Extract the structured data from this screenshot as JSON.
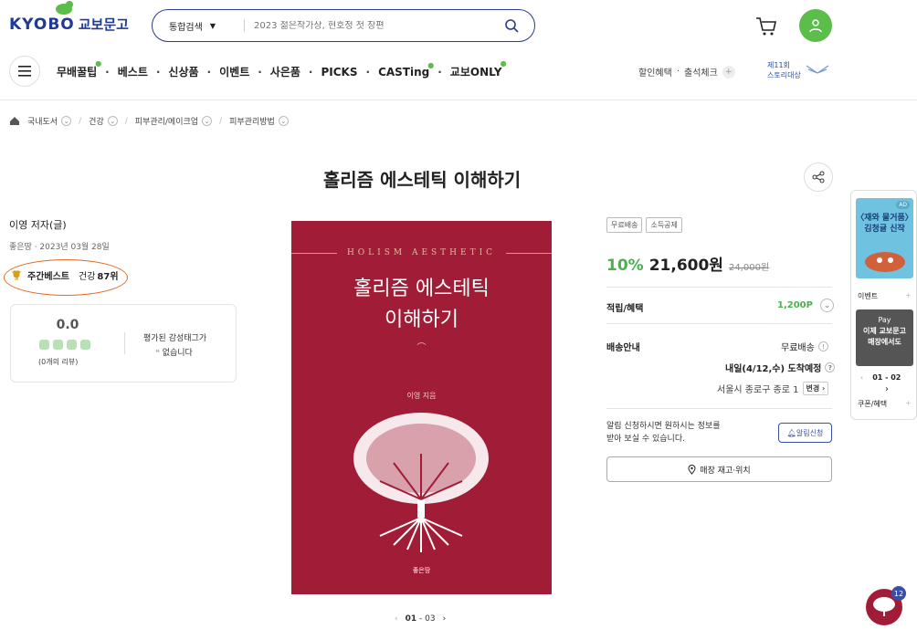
{
  "header": {
    "logo_en": "KYOBO",
    "logo_ko": "교보문고",
    "search_type": "통합검색",
    "search_placeholder": "2023 젊은작가상, 현호정 첫 장편",
    "nav": [
      "무배꿀팁",
      "베스트",
      "신상품",
      "이벤트",
      "사은품",
      "PICKS",
      "CASTing",
      "교보ONLY"
    ],
    "util": [
      "할인혜택",
      "출석체크"
    ],
    "award": [
      "제11회",
      "스토리대상"
    ]
  },
  "breadcrumb": [
    "국내도서",
    "건강",
    "피부관리/메이크업",
    "피부관리방법"
  ],
  "book_title": "홀리즘 에스테틱 이해하기",
  "author": "이영 저자(글)",
  "publisher_date": "좋은땅 · 2023년 03월 28일",
  "best": {
    "label": "주간베스트",
    "category": "건강",
    "rank": "87위"
  },
  "review": {
    "score": "0.0",
    "count": "(0개의 리뷰)",
    "tag_line1": "평가된 감성태그가",
    "tag_line2": "없습니다"
  },
  "cover": {
    "eng": "HOLISM AESTHETIC",
    "line1": "홀리즘 에스테틱",
    "line2": "이해하기",
    "author": "이영 지음",
    "publisher": "좋은땅"
  },
  "pager": {
    "current": "01",
    "total": "03"
  },
  "purchase": {
    "badges": [
      "무료배송",
      "소득공제"
    ],
    "discount": "10%",
    "price": "21,600원",
    "original": "24,000원",
    "points_label": "적립/혜택",
    "points": "1,200P",
    "delivery_label": "배송안내",
    "delivery": "무료배송",
    "arrival": "내일(4/12,수) 도착예정",
    "address": "서울시 종로구 종로 1",
    "change": "변경",
    "alert_text1": "알림 신청하시면 원하시는 정보를",
    "alert_text2": "받아 보실 수 있습니다.",
    "alert_btn": "알림신청",
    "store_btn": "매장 재고·위치"
  },
  "side": {
    "ad_tag": "AD",
    "ad_line1": "〈재와 물거품〉",
    "ad_line2": "김청귤 신작",
    "event": "이벤트",
    "pay_line1": "Pay",
    "pay_line2": "이제 교보문고",
    "pay_line3": "매장에서도",
    "pager": "01 - 02",
    "coupon": "쿠폰/혜택"
  },
  "fab_count": "12"
}
